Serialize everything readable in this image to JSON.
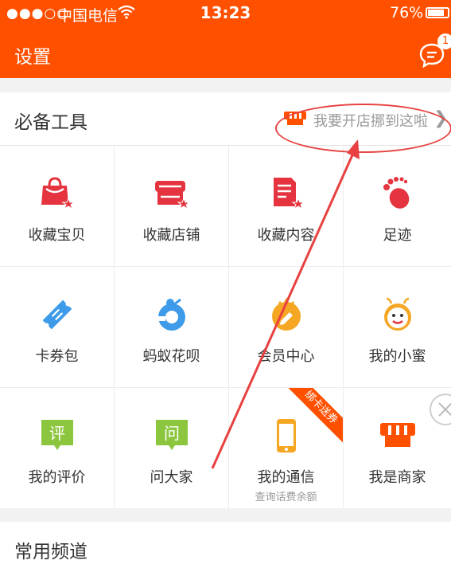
{
  "status_bar": {
    "signal": "●●●○○",
    "carrier": "中国电信",
    "time": "13:23",
    "battery": "76%"
  },
  "header": {
    "title": "设置",
    "message_badge": "1"
  },
  "tools_section": {
    "title": "必备工具",
    "link_text": "我要开店挪到这啦"
  },
  "grid": [
    {
      "label": "收藏宝贝",
      "icon": "bag-star-icon"
    },
    {
      "label": "收藏店铺",
      "icon": "shop-star-icon"
    },
    {
      "label": "收藏内容",
      "icon": "doc-star-icon"
    },
    {
      "label": "足迹",
      "icon": "footprint-icon"
    },
    {
      "label": "卡券包",
      "icon": "ticket-icon"
    },
    {
      "label": "蚂蚁花呗",
      "icon": "huabei-icon"
    },
    {
      "label": "会员中心",
      "icon": "member-icon"
    },
    {
      "label": "我的小蜜",
      "icon": "xiaomi-face-icon"
    },
    {
      "label": "我的评价",
      "icon": "review-icon",
      "glyph": "评"
    },
    {
      "label": "问大家",
      "icon": "ask-icon",
      "glyph": "问"
    },
    {
      "label": "我的通信",
      "icon": "phone-icon",
      "sub": "查询话费余额",
      "ribbon": "绑卡送券"
    },
    {
      "label": "我是商家",
      "icon": "seller-shop-icon"
    }
  ],
  "channels_section": {
    "title": "常用频道"
  },
  "colors": {
    "brand": "#ff5000",
    "red_icon": "#e5343f",
    "blue_icon": "#3d9be9",
    "orange_icon": "#f5a623",
    "green_icon": "#8cc63e",
    "annotation": "#e84040"
  }
}
